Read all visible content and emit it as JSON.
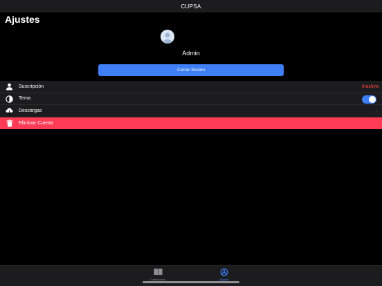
{
  "app": {
    "title": "CUPSA"
  },
  "page": {
    "title": "Ajustes"
  },
  "profile": {
    "username": "Admin",
    "logout_label": "Cerrar Sesión"
  },
  "settings": {
    "subscription": {
      "label": "Suscripción",
      "value": "Inactiva",
      "value_color": "#ff453a",
      "icon": "person-icon"
    },
    "theme": {
      "label": "Tema",
      "toggle_on": true,
      "icon": "theme-icon"
    },
    "downloads": {
      "label": "Descargas",
      "icon": "cloud-download-icon"
    },
    "delete_account": {
      "label": "Eliminar Cuenta",
      "icon": "trash-icon",
      "background": "#ff3b55"
    }
  },
  "tabbar": {
    "tabs": [
      {
        "label": "Colecciones",
        "icon": "book-icon",
        "active": false
      },
      {
        "label": "Ajustes",
        "icon": "settings-icon",
        "active": true
      }
    ],
    "active_color": "#3e7ff6",
    "inactive_color": "#8e8e93"
  },
  "colors": {
    "accent": "#3e7ff6",
    "danger": "#ff3b55",
    "background": "#000000",
    "surface": "#1c1c1e"
  }
}
